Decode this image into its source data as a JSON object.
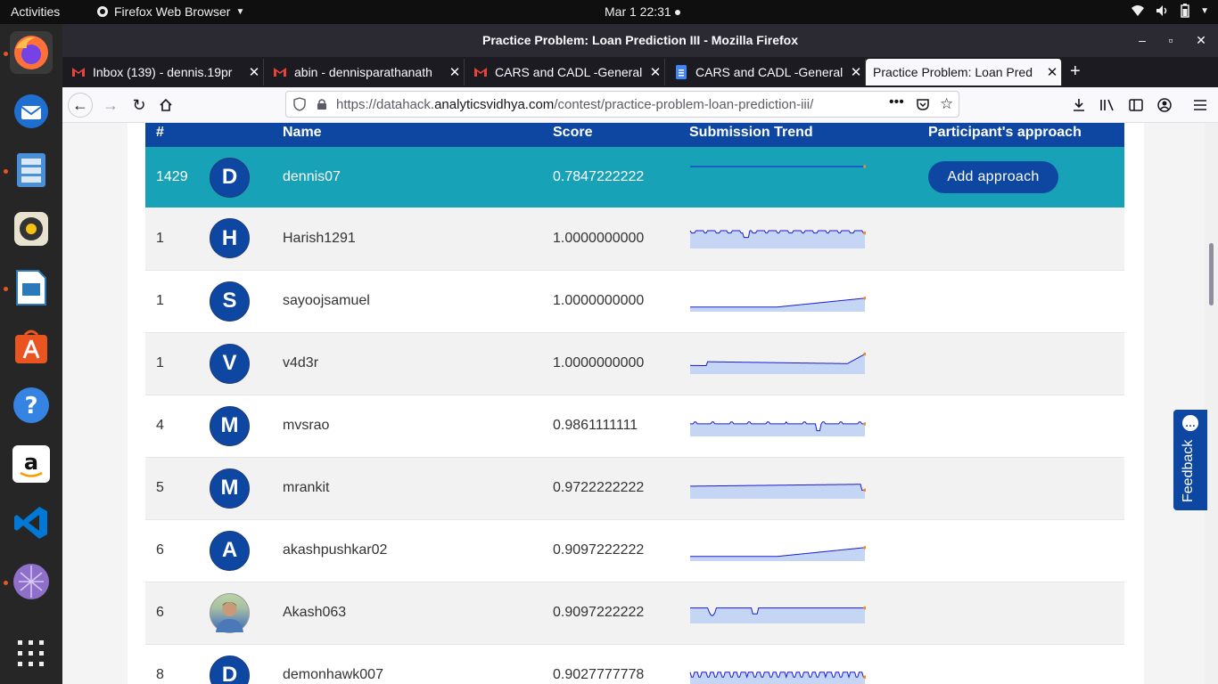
{
  "topbar": {
    "activities": "Activities",
    "app_name": "Firefox Web Browser",
    "clock": "Mar 1  22:31"
  },
  "dock": {
    "items": [
      "firefox-icon",
      "thunderbird-icon",
      "files-icon",
      "rhythmbox-icon",
      "libreoffice-impress-icon",
      "software-center-icon",
      "help-icon",
      "amazon-icon",
      "vscode-icon",
      "network-app-icon",
      "show-apps-icon"
    ]
  },
  "window": {
    "title": "Practice Problem: Loan Prediction III - Mozilla Firefox"
  },
  "tabs": [
    {
      "label": "Inbox (139) - dennis.19pr",
      "icon": "gmail-icon"
    },
    {
      "label": "abin - dennisparathanath",
      "icon": "gmail-icon"
    },
    {
      "label": "CARS and CADL -General",
      "icon": "gmail-icon"
    },
    {
      "label": "CARS and CADL -General",
      "icon": "docs-icon"
    },
    {
      "label": "Practice Problem: Loan Pred",
      "icon": "none",
      "active": true
    }
  ],
  "urlbar": {
    "prefix": "https://datahack.",
    "host": "analyticsvidhya.com",
    "path": "/contest/practice-problem-loan-prediction-iii/"
  },
  "leaderboard": {
    "headers": {
      "rank": "#",
      "name": "Name",
      "score": "Score",
      "trend": "Submission Trend",
      "approach": "Participant's approach"
    },
    "current_user": {
      "rank": "1429",
      "initial": "D",
      "name": "dennis07",
      "score": "0.7847222222",
      "button": "Add approach"
    },
    "rows": [
      {
        "rank": "1",
        "initial": "H",
        "name": "Harish1291",
        "score": "1.0000000000"
      },
      {
        "rank": "1",
        "initial": "S",
        "name": "sayoojsamuel",
        "score": "1.0000000000"
      },
      {
        "rank": "1",
        "initial": "V",
        "name": "v4d3r",
        "score": "1.0000000000"
      },
      {
        "rank": "4",
        "initial": "M",
        "name": "mvsrao",
        "score": "0.9861111111"
      },
      {
        "rank": "5",
        "initial": "M",
        "name": "mrankit",
        "score": "0.9722222222"
      },
      {
        "rank": "6",
        "initial": "A",
        "name": "akashpushkar02",
        "score": "0.9097222222"
      },
      {
        "rank": "6",
        "initial": "",
        "name": "Akash063",
        "score": "0.9097222222",
        "photo": true
      },
      {
        "rank": "8",
        "initial": "D",
        "name": "demonhawk007",
        "score": "0.9027777778"
      }
    ]
  },
  "feedback": {
    "label": "Feedback"
  },
  "colors": {
    "primary": "#0d47a1",
    "highlight": "#17a2b8",
    "trend_fill": "#c5d6f5"
  }
}
